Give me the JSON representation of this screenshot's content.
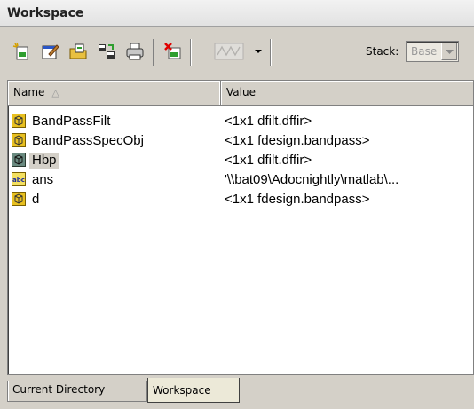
{
  "window": {
    "title": "Workspace"
  },
  "toolbar": {
    "buttons": [
      {
        "icon": "new-variable-icon"
      },
      {
        "icon": "open-selection-icon"
      },
      {
        "icon": "load-data-icon"
      },
      {
        "icon": "save-icon"
      },
      {
        "icon": "print-icon"
      },
      {
        "icon": "delete-icon"
      },
      {
        "icon": "plot-icon"
      },
      {
        "icon": "dropdown-arrow-icon"
      }
    ],
    "stack_label": "Stack:",
    "stack_value": "Base"
  },
  "table": {
    "columns": [
      "Name",
      "Value"
    ],
    "rows": [
      {
        "name": "BandPassFilt",
        "value": "<1x1 dfilt.dffir>",
        "icon": "object-icon"
      },
      {
        "name": "BandPassSpecObj",
        "value": "<1x1 fdesign.bandpass>",
        "icon": "object-icon"
      },
      {
        "name": "Hbp",
        "value": "<1x1 dfilt.dffir>",
        "icon": "object-icon",
        "selected": true
      },
      {
        "name": "ans",
        "value": "'\\\\bat09\\Adocnightly\\matlab\\...",
        "icon": "string-icon"
      },
      {
        "name": "d",
        "value": "<1x1 fdesign.bandpass>",
        "icon": "object-icon"
      }
    ]
  },
  "tabs": [
    {
      "label": "Current Directory",
      "active": false
    },
    {
      "label": "Workspace",
      "active": true
    }
  ],
  "colors": {
    "panel": "#d4d0c8",
    "selection": "#d4d0c8",
    "object_icon": "#e8c020"
  }
}
